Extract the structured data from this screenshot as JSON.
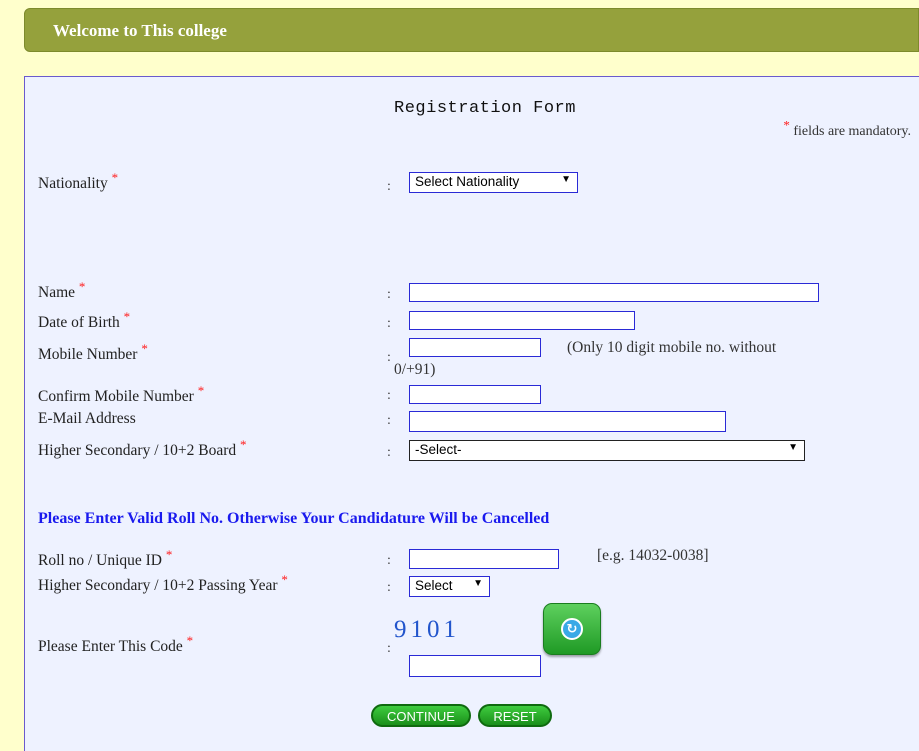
{
  "header": {
    "title": "Welcome to This college"
  },
  "form": {
    "title": "Registration Form",
    "mandatory_note": "fields are mandatory.",
    "star": "*",
    "colon": ":",
    "nationality": {
      "label": "Nationality",
      "value": "Select Nationality"
    },
    "name": {
      "label": "Name",
      "value": ""
    },
    "dob": {
      "label": "Date of Birth",
      "value": ""
    },
    "mobile": {
      "label": "Mobile Number",
      "value": "",
      "hint_line1": "(Only 10 digit mobile no. without",
      "hint_line2": "0/+91)"
    },
    "confirm_mobile": {
      "label": "Confirm Mobile Number",
      "value": ""
    },
    "email": {
      "label": "E-Mail Address",
      "value": ""
    },
    "board": {
      "label": "Higher Secondary / 10+2 Board",
      "value": "-Select-"
    },
    "notice": "Please Enter Valid Roll No. Otherwise Your Candidature Will be Cancelled",
    "roll": {
      "label": "Roll no / Unique ID",
      "value": "",
      "hint": "[e.g. 14032-0038]"
    },
    "passing_year": {
      "label": "Higher Secondary / 10+2 Passing Year",
      "value": "Select"
    },
    "captcha": {
      "label": "Please Enter This Code",
      "code": "9101",
      "value": ""
    },
    "buttons": {
      "continue": "CONTINUE",
      "reset": "RESET"
    }
  },
  "colors": {
    "header_bg": "#95a13c",
    "panel_bg": "#eef2ff",
    "notice": "#1a1aee",
    "button": "#22a822"
  }
}
